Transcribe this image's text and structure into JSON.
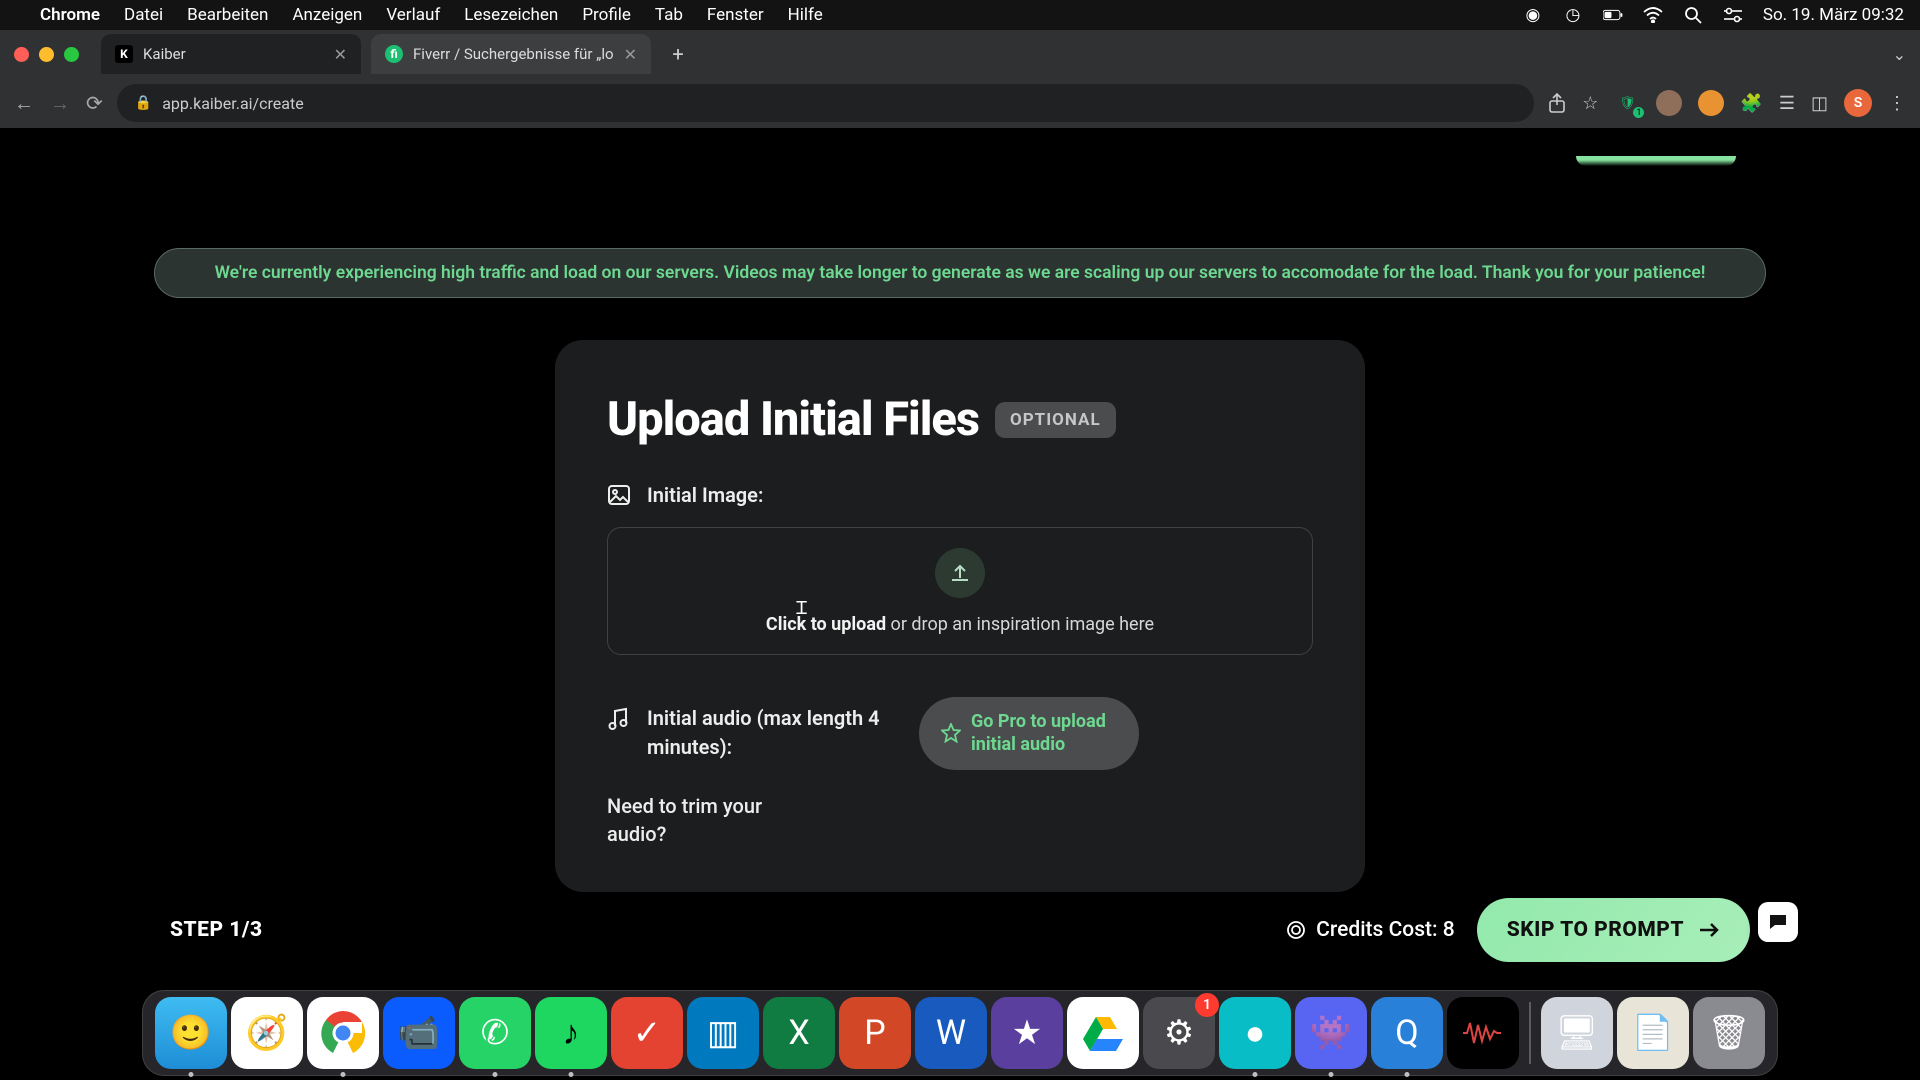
{
  "menubar": {
    "app": "Chrome",
    "items": [
      "Datei",
      "Bearbeiten",
      "Anzeigen",
      "Verlauf",
      "Lesezeichen",
      "Profile",
      "Tab",
      "Fenster",
      "Hilfe"
    ],
    "datetime": "So. 19. März  09:32"
  },
  "tabs": {
    "active": {
      "title": "Kaiber",
      "favicon": "K"
    },
    "second": {
      "title": "Fiverr / Suchergebnisse für „lo",
      "favicon": "fi"
    }
  },
  "url": "app.kaiber.ai/create",
  "avatar_letter": "S",
  "banner": "We're currently experiencing high traffic and load on our servers. Videos may take longer to generate as we are scaling up our servers to accomodate for the load. Thank you for your patience!",
  "card": {
    "title": "Upload Initial Files",
    "badge": "OPTIONAL",
    "image_label": "Initial Image:",
    "drop_bold": "Click to upload",
    "drop_rest": " or drop an inspiration image here",
    "audio_label": "Initial audio (max length 4 minutes):",
    "go_pro": "Go Pro to upload initial audio",
    "trim": "Need to trim your audio?"
  },
  "footer": {
    "step": "STEP 1/3",
    "credits_label": "Credits Cost: ",
    "credits_value": "8",
    "skip": "SKIP TO PROMPT"
  },
  "dock_badge": "1"
}
